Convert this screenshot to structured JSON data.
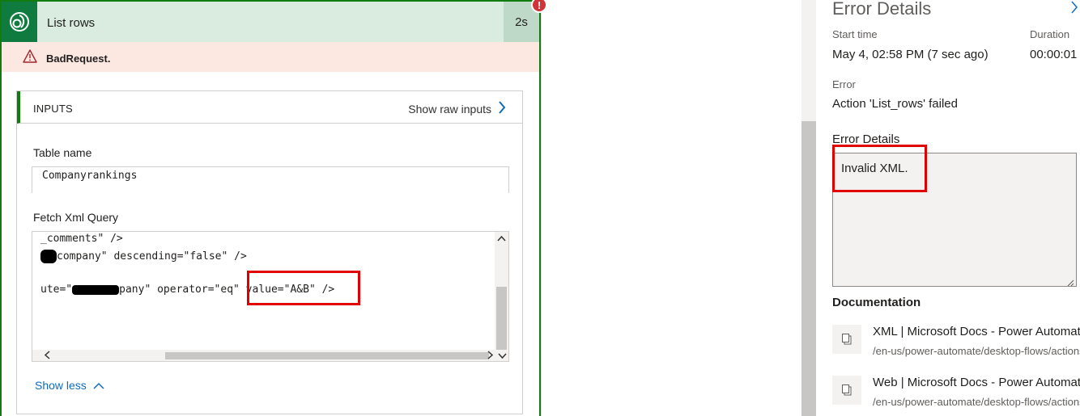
{
  "card": {
    "title": "List rows",
    "duration": "2s",
    "error_badge": "!",
    "error_message": "BadRequest."
  },
  "inputs": {
    "header": "INPUTS",
    "show_raw": "Show raw inputs",
    "table_name_label": "Table name",
    "table_name_value": "Companyrankings",
    "fetch_label": "Fetch Xml Query",
    "code_line1": "_comments\" />",
    "code_line2_rest": "company\" descending=\"false\" />",
    "code_line3_pre": "ute=\"",
    "code_line3_mid": "pany\" operator=\"eq\" value=\"A&B\" />",
    "show_less": "Show less"
  },
  "panel": {
    "title": "Error Details",
    "start_label": "Start time",
    "start_value": "May 4, 02:58 PM (7 sec ago)",
    "duration_label": "Duration",
    "duration_value": "00:00:01",
    "error_label": "Error",
    "error_value": "Action 'List_rows' failed",
    "details_label": "Error Details",
    "details_text": "Invalid XML.",
    "documentation_label": "Documentation",
    "docs": [
      {
        "title": "XML | Microsoft Docs - Power Automate",
        "url": "/en-us/power-automate/desktop-flows/actions-reference/xml"
      },
      {
        "title": "Web | Microsoft Docs - Power Automate",
        "url": "/en-us/power-automate/desktop-flows/actions-reference/web"
      }
    ]
  },
  "colors": {
    "success_green": "#107c10",
    "error_red": "#d13438",
    "link_blue": "#0f6cbd",
    "header_bg": "#d9ecdf",
    "error_bg": "#fde7e1"
  }
}
